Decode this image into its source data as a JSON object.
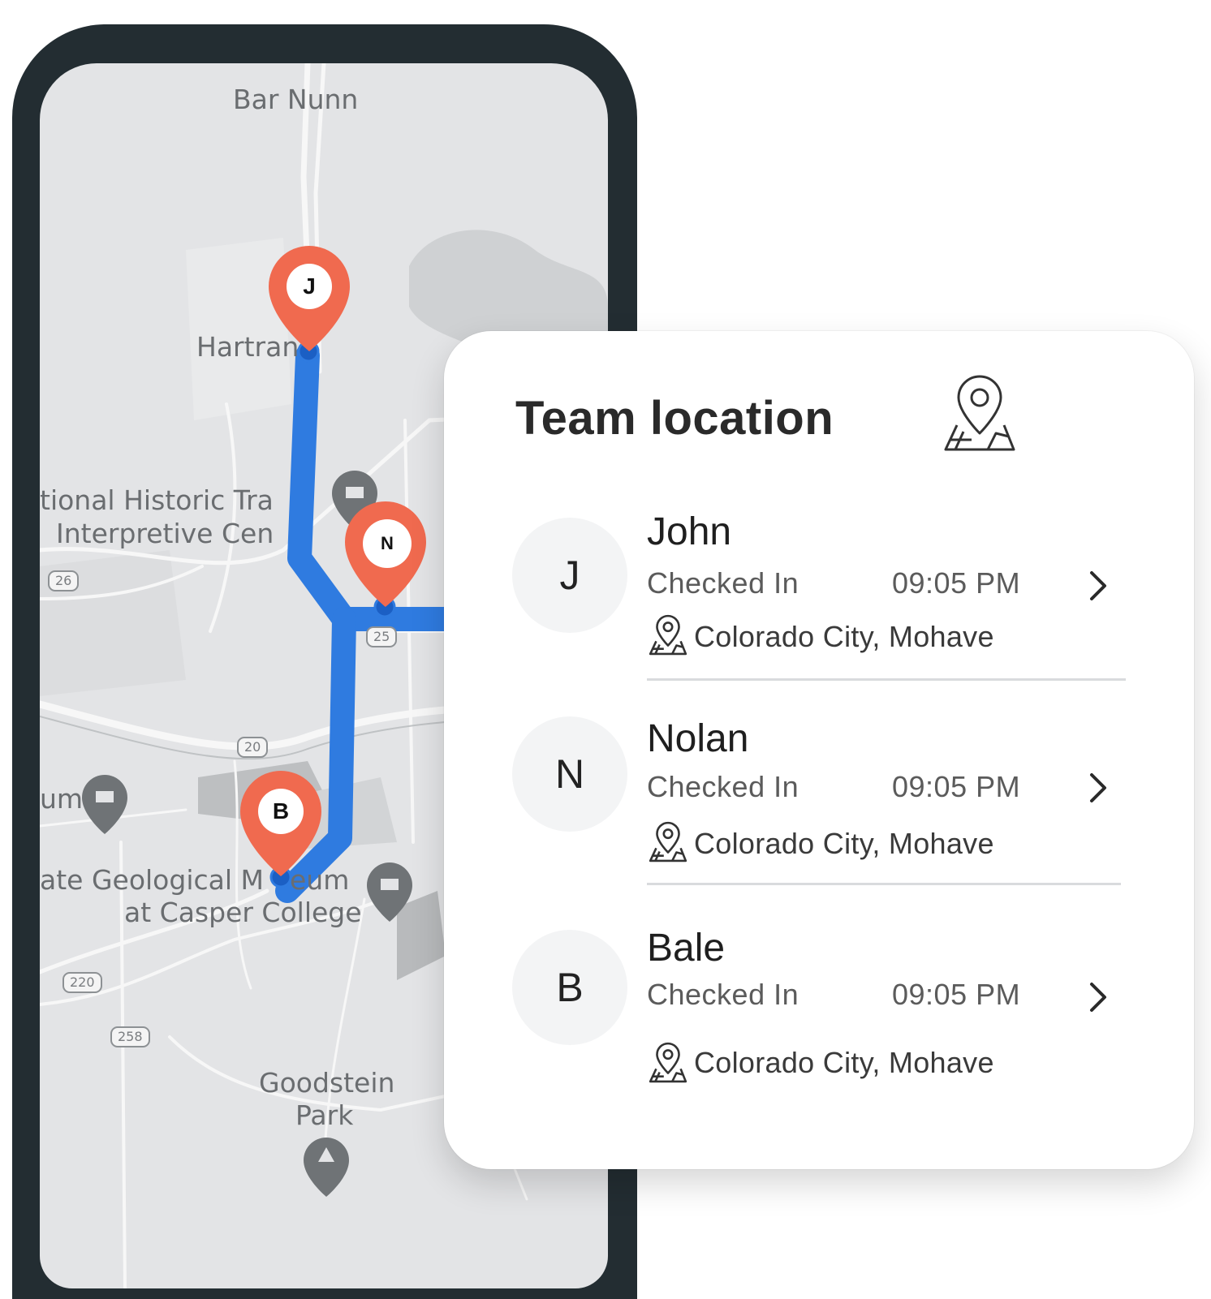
{
  "map": {
    "labels": {
      "bar_nunn": "Bar Nunn",
      "hartrant": "Hartran",
      "historic_trail_1": "tional Historic Tra",
      "historic_trail_2": "Interpretive Cen",
      "museum_fragment": "um",
      "geo_museum_1": "ate Geological M",
      "geo_museum_1b": "eum",
      "geo_museum_2": "at Casper College",
      "goodstein_1": "Goodstein",
      "goodstein_2": "Park"
    },
    "shields": [
      "26",
      "25",
      "20",
      "220",
      "258"
    ],
    "markers": [
      {
        "letter": "J",
        "name": "john-map-pin"
      },
      {
        "letter": "N",
        "name": "nolan-map-pin"
      },
      {
        "letter": "B",
        "name": "bale-map-pin"
      }
    ],
    "colors": {
      "route": "#2f7be0",
      "pin": "#f06a4f",
      "frame": "#232d32"
    }
  },
  "card": {
    "title": "Team location",
    "members": [
      {
        "initial": "J",
        "name": "John",
        "status": "Checked In",
        "time": "09:05 PM",
        "location": "Colorado City, Mohave"
      },
      {
        "initial": "N",
        "name": "Nolan",
        "status": "Checked In",
        "time": "09:05 PM",
        "location": "Colorado City, Mohave"
      },
      {
        "initial": "B",
        "name": "Bale",
        "status": "Checked In",
        "time": "09:05 PM",
        "location": "Colorado City, Mohave"
      }
    ]
  }
}
